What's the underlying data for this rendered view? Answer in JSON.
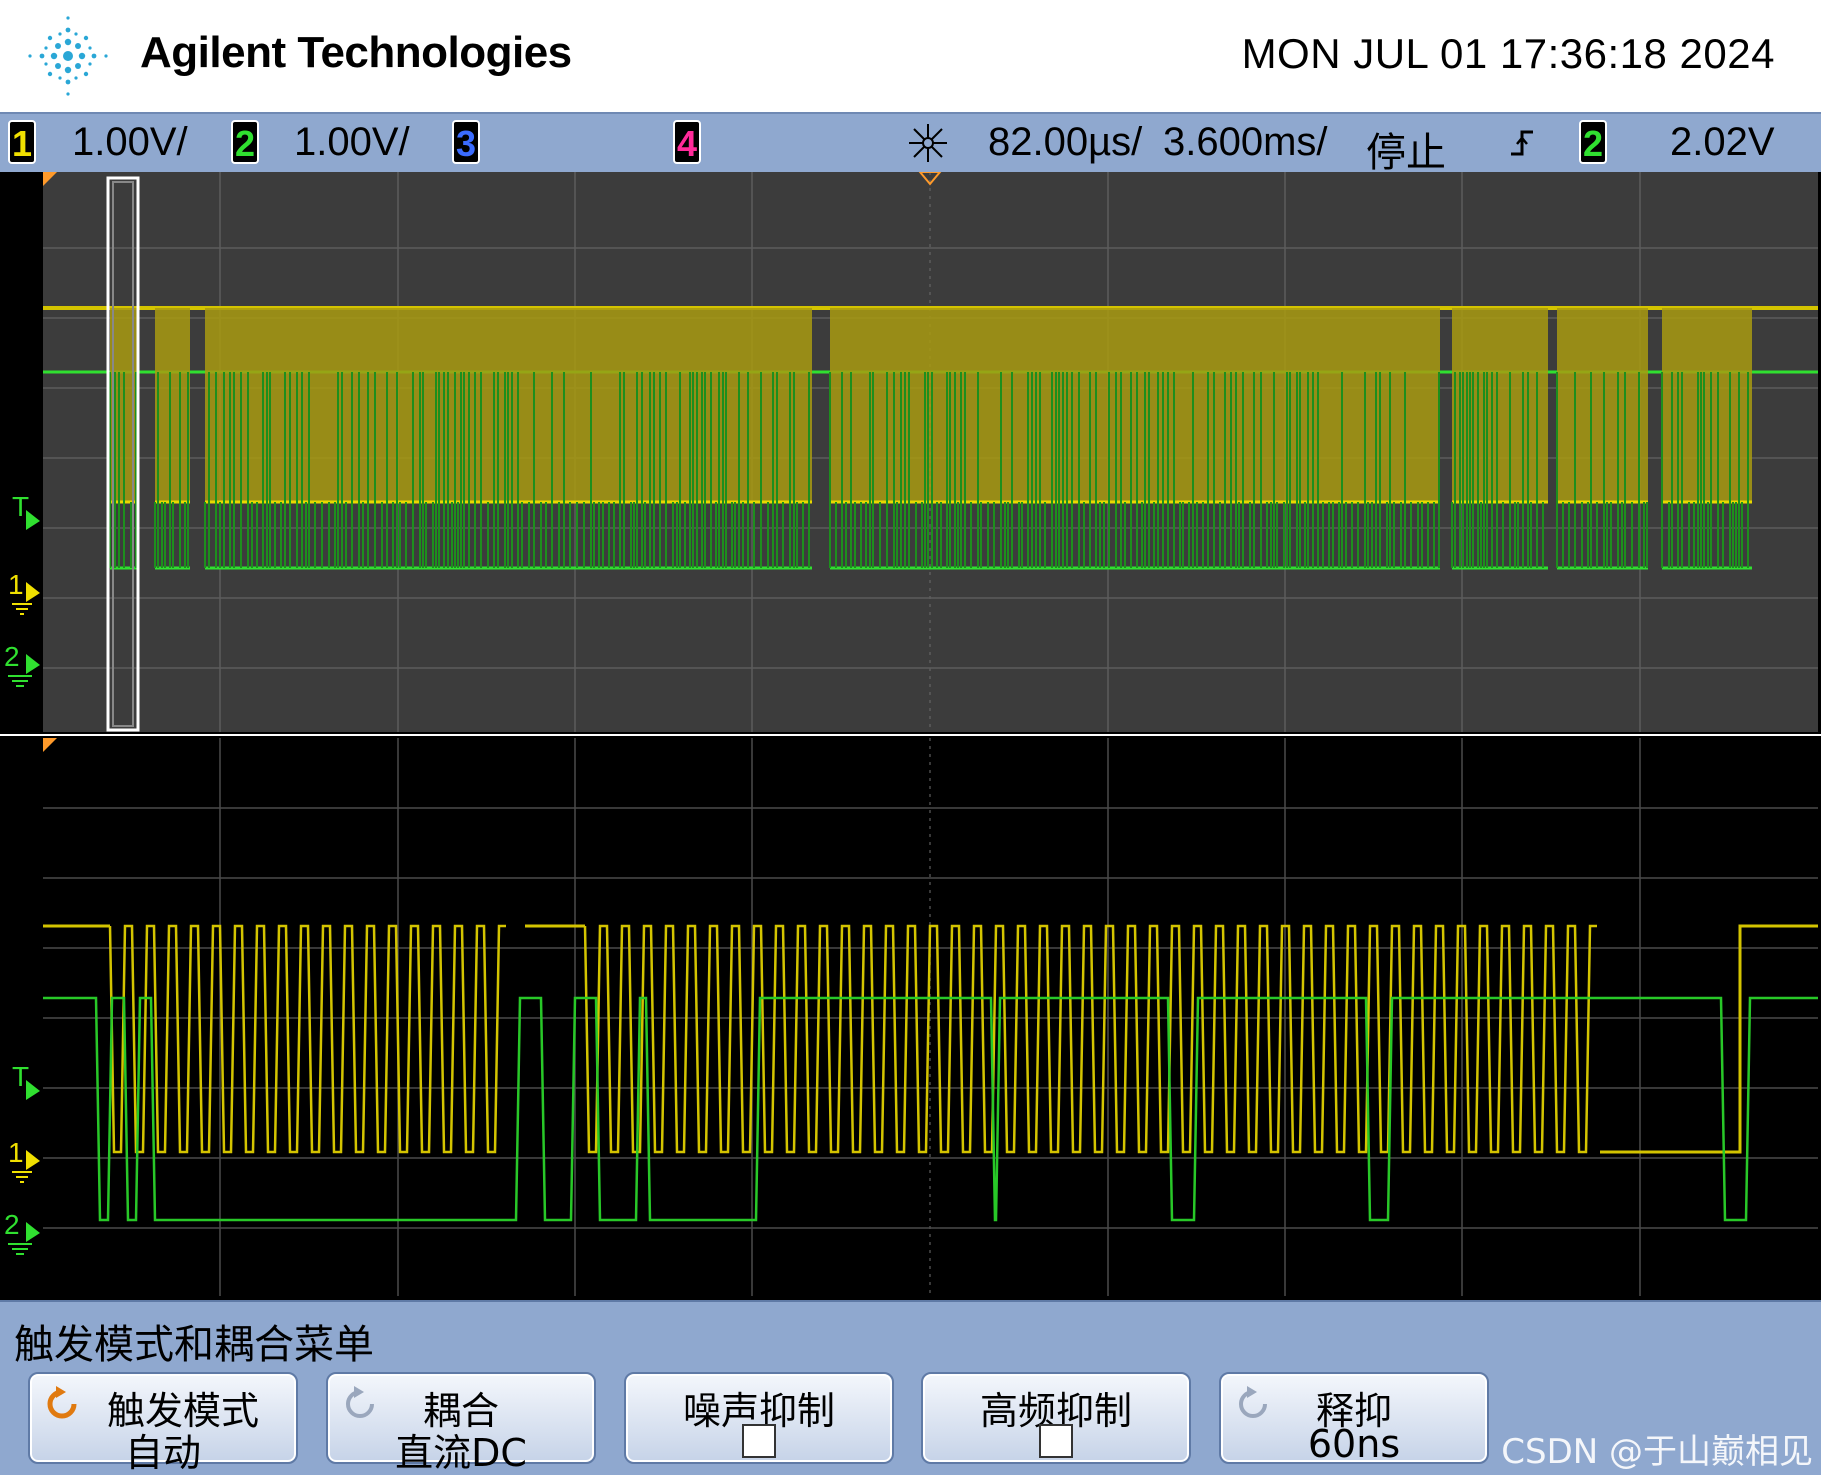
{
  "header": {
    "brand": "Agilent Technologies",
    "datetime": "MON JUL 01 17:36:18 2024"
  },
  "status_bar": {
    "ch1_label": "1",
    "ch1_scale": "1.00V/",
    "ch2_label": "2",
    "ch2_scale": "1.00V/",
    "ch3_label": "3",
    "ch4_label": "4",
    "time_position": "82.00µs/",
    "time_scale": "3.600ms/",
    "run_state": "停止",
    "trigger_source": "2",
    "trigger_level": "2.02V",
    "colors": {
      "ch1": "#f0e000",
      "ch2": "#30e030",
      "ch3": "#3b6cff",
      "ch4": "#ff2a9a"
    }
  },
  "scope": {
    "upper_markers": {
      "trigger": "T",
      "ch1_ground": "1",
      "ch2_ground": "2"
    },
    "lower_markers": {
      "trigger": "T",
      "ch1_ground": "1",
      "ch2_ground": "2"
    }
  },
  "menu": {
    "title": "触发模式和耦合菜单",
    "softkeys": [
      {
        "line1": "触发模式",
        "line2": "自动",
        "icon": "rotate-icon"
      },
      {
        "line1": "耦合",
        "line2": "直流DC",
        "icon": "rotate-icon"
      },
      {
        "line1": "噪声抑制",
        "checkbox": false
      },
      {
        "line1": "高频抑制",
        "checkbox": false
      },
      {
        "line1": "释抑",
        "line2": "60ns",
        "icon": "rotate-icon"
      }
    ]
  },
  "watermark": "CSDN @于山巅相见"
}
